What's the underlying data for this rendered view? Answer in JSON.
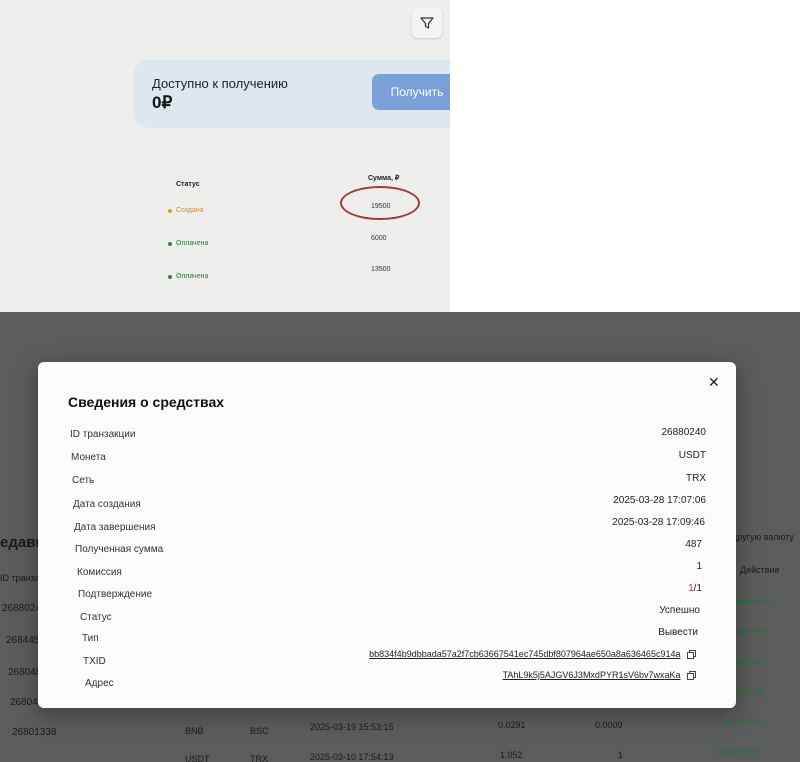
{
  "top": {
    "balance": {
      "title": "Доступно к получению",
      "amount": "0₽",
      "button_label": "Получить"
    },
    "table": {
      "header_status": "Статус",
      "header_sum": "Сумма, ₽",
      "rows": [
        {
          "status": "Создана",
          "sum": "19500"
        },
        {
          "status": "Оплачена",
          "sum": "6000"
        },
        {
          "status": "Оплачена",
          "sum": "13500"
        }
      ]
    },
    "colors": {
      "created": "#e0a030",
      "paid": "#2a8a3c",
      "highlight_circle": "#a33a3a"
    }
  },
  "background": {
    "title_fragment": "едавни",
    "col_id_header": "ID транзакци",
    "col_right_header_1": "другую валюту",
    "col_action_header": "Действие",
    "ids": [
      "26880240",
      "26844510",
      "26804846",
      "26804054",
      "26801338"
    ],
    "action_label": "Подробнее",
    "partial_row": {
      "coin": "BNB",
      "network": "BSC",
      "date": "2025-03-19 15:53:15",
      "amount": "0.0291",
      "fee": "0.0009"
    },
    "partial_row_2": {
      "coin": "USDT",
      "network": "TRX",
      "date": "2025-03-10 17:54:13",
      "amount": "1.052",
      "fee": "1"
    }
  },
  "modal": {
    "title": "Сведения о средствах",
    "fields": {
      "tx_id": {
        "label": "ID транзакции",
        "value": "26880240"
      },
      "coin": {
        "label": "Монета",
        "value": "USDT"
      },
      "network": {
        "label": "Сеть",
        "value": "TRX"
      },
      "created": {
        "label": "Дата создания",
        "value": "2025-03-28 17:07:06"
      },
      "completed": {
        "label": "Дата завершения",
        "value": "2025-03-28 17:09:46"
      },
      "received": {
        "label": "Полученная сумма",
        "value": "487"
      },
      "fee": {
        "label": "Комиссия",
        "value": "1"
      },
      "confirmation": {
        "label": "Подтверждение",
        "value_current": "1",
        "value_total": "/1"
      },
      "status": {
        "label": "Статус",
        "value": "Успешно"
      },
      "type": {
        "label": "Тип",
        "value": "Вывести"
      },
      "txid": {
        "label": "TXID",
        "value": "bb834f4b9dbbada57a2f7cb63667541ec745dbf807964ae650a8a636465c914a"
      },
      "address": {
        "label": "Адрес",
        "value": "TAhL9k5j5AJGV6J3MxdPYR1sV6bv7wxaKa"
      }
    },
    "colors": {
      "confirmation_current": "#d0332e"
    }
  }
}
